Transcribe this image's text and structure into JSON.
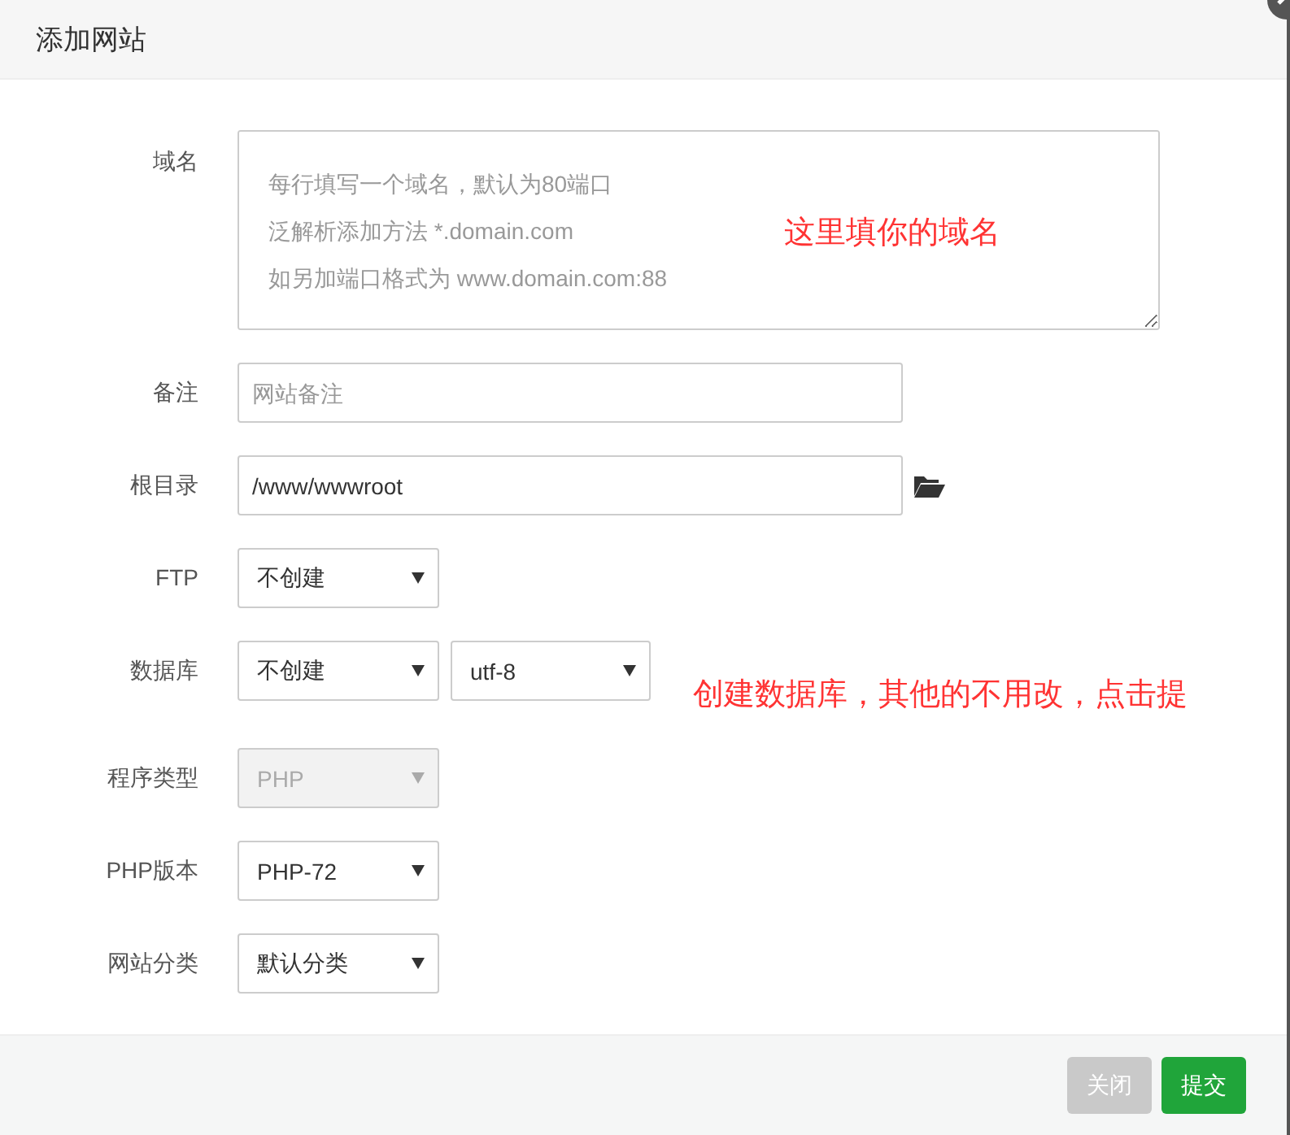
{
  "dialog": {
    "title": "添加网站"
  },
  "fields": [
    {
      "label": "域名",
      "kind": "textarea",
      "placeholder": [
        "每行填写一个域名，默认为80端口",
        "泛解析添加方法 *.domain.com",
        "如另加端口格式为 www.domain.com:88"
      ],
      "annotation": "这里填你的域名"
    },
    {
      "label": "备注",
      "kind": "input",
      "placeholder": "网站备注"
    },
    {
      "label": "根目录",
      "kind": "path",
      "value": "/www/wwwroot"
    },
    {
      "label": "FTP",
      "kind": "select",
      "selects": [
        {
          "value": "不创建",
          "disabled": false
        }
      ]
    },
    {
      "label": "数据库",
      "kind": "select",
      "selects": [
        {
          "value": "不创建",
          "disabled": false
        },
        {
          "value": "utf-8",
          "disabled": false
        }
      ],
      "annotation": "创建数据库，其他的不用改，点击提"
    },
    {
      "label": "程序类型",
      "kind": "select",
      "selects": [
        {
          "value": "PHP",
          "disabled": true
        }
      ]
    },
    {
      "label": "PHP版本",
      "kind": "select",
      "selects": [
        {
          "value": "PHP-72",
          "disabled": false
        }
      ]
    },
    {
      "label": "网站分类",
      "kind": "select",
      "selects": [
        {
          "value": "默认分类",
          "disabled": false
        }
      ]
    }
  ],
  "buttons": [
    {
      "label": "关闭",
      "kind": "default"
    },
    {
      "label": "提交",
      "kind": "primary"
    }
  ]
}
